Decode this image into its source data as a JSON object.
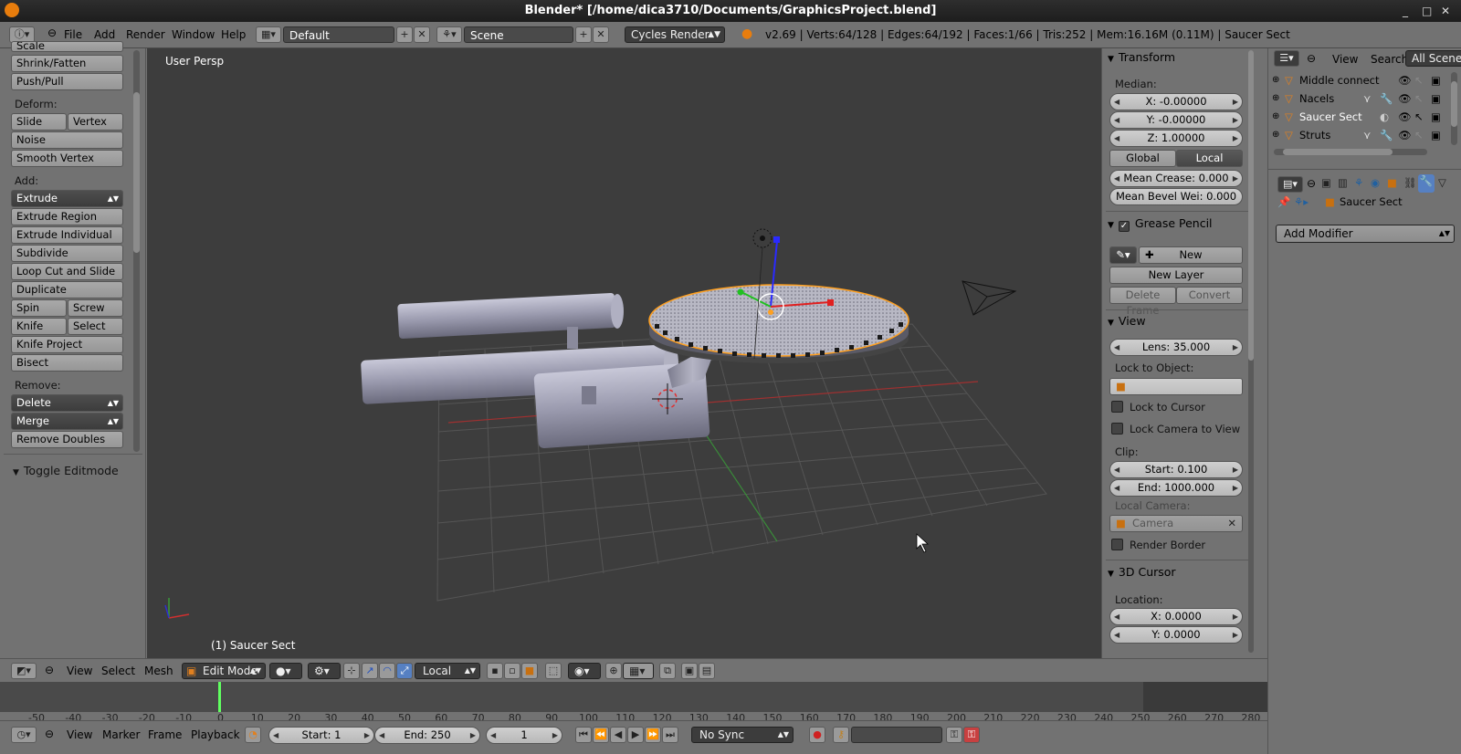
{
  "window": {
    "title": "Blender* [/home/dica3710/Documents/GraphicsProject.blend]",
    "controls": [
      "_",
      "□",
      "✕"
    ]
  },
  "topbar": {
    "menus": [
      "File",
      "Add",
      "Render",
      "Window",
      "Help"
    ],
    "layout": "Default",
    "scene": "Scene",
    "engine": "Cycles Render",
    "stats": "v2.69 | Verts:64/128 | Edges:64/192 | Faces:1/66 | Tris:252 | Mem:16.16M (0.11M) | Saucer Sect"
  },
  "toolshelf": {
    "top_cut": "Scale",
    "transform_buttons": [
      "Shrink/Fatten",
      "Push/Pull"
    ],
    "deform_label": "Deform:",
    "slide_edge": "Slide Edge",
    "vertex": "Vertex",
    "noise": "Noise",
    "smooth_vertex": "Smooth Vertex",
    "add_label": "Add:",
    "extrude": "Extrude",
    "extrude_region": "Extrude Region",
    "extrude_individual": "Extrude Individual",
    "subdivide": "Subdivide",
    "loop_cut": "Loop Cut and Slide",
    "duplicate": "Duplicate",
    "spin": "Spin",
    "screw": "Screw",
    "knife": "Knife",
    "select": "Select",
    "knife_project": "Knife Project",
    "bisect": "Bisect",
    "remove_label": "Remove:",
    "delete": "Delete",
    "merge": "Merge",
    "remove_doubles": "Remove Doubles",
    "toggle_editmode": "Toggle Editmode"
  },
  "viewport": {
    "view_label": "User Persp",
    "object_label": "(1) Saucer Sect"
  },
  "npanel": {
    "transform": "Transform",
    "median": "Median:",
    "x": "X: -0.00000",
    "y": "Y: -0.00000",
    "z": "Z: 1.00000",
    "global": "Global",
    "local": "Local",
    "mean_crease": "Mean Crease: 0.000",
    "mean_bevel": "Mean Bevel Wei: 0.000",
    "grease_pencil": "Grease Pencil",
    "new": "New",
    "new_layer": "New Layer",
    "delete_frame": "Delete Frame",
    "convert": "Convert",
    "view": "View",
    "lens": "Lens: 35.000",
    "lock_to_object": "Lock to Object:",
    "lock_to_cursor": "Lock to Cursor",
    "lock_camera": "Lock Camera to View",
    "clip": "Clip:",
    "clip_start": "Start: 0.100",
    "clip_end": "End: 1000.000",
    "local_camera": "Local Camera:",
    "camera": "Camera",
    "render_border": "Render Border",
    "cursor3d": "3D Cursor",
    "location": "Location:",
    "cx": "X: 0.0000",
    "cy": "Y: 0.0000"
  },
  "outliner": {
    "view": "View",
    "search": "Search",
    "all_scenes": "All Scenes",
    "items": [
      "Middle connect",
      "Nacels",
      "Saucer Sect",
      "Struts"
    ]
  },
  "properties": {
    "object_name": "Saucer Sect",
    "add_modifier": "Add Modifier"
  },
  "view3d_header": {
    "menus": [
      "View",
      "Select",
      "Mesh"
    ],
    "mode": "Edit Mode",
    "orientation": "Local"
  },
  "timeline": {
    "ticks": [
      "-50",
      "-40",
      "-30",
      "-20",
      "-10",
      "0",
      "10",
      "20",
      "30",
      "40",
      "50",
      "60",
      "70",
      "80",
      "90",
      "100",
      "110",
      "120",
      "130",
      "140",
      "150",
      "160",
      "170",
      "180",
      "190",
      "200",
      "210",
      "220",
      "230",
      "240",
      "250",
      "260",
      "270",
      "280"
    ],
    "menus": [
      "View",
      "Marker",
      "Frame",
      "Playback"
    ],
    "start": "Start: 1",
    "end": "End: 250",
    "current": "1",
    "sync": "No Sync"
  },
  "colors": {
    "selection": "#ffa020",
    "viewport_bg": "#3d3d3d",
    "ui_bg": "#727272",
    "button_dark": "#3c3c3c",
    "frame_marker": "#60ff60"
  }
}
